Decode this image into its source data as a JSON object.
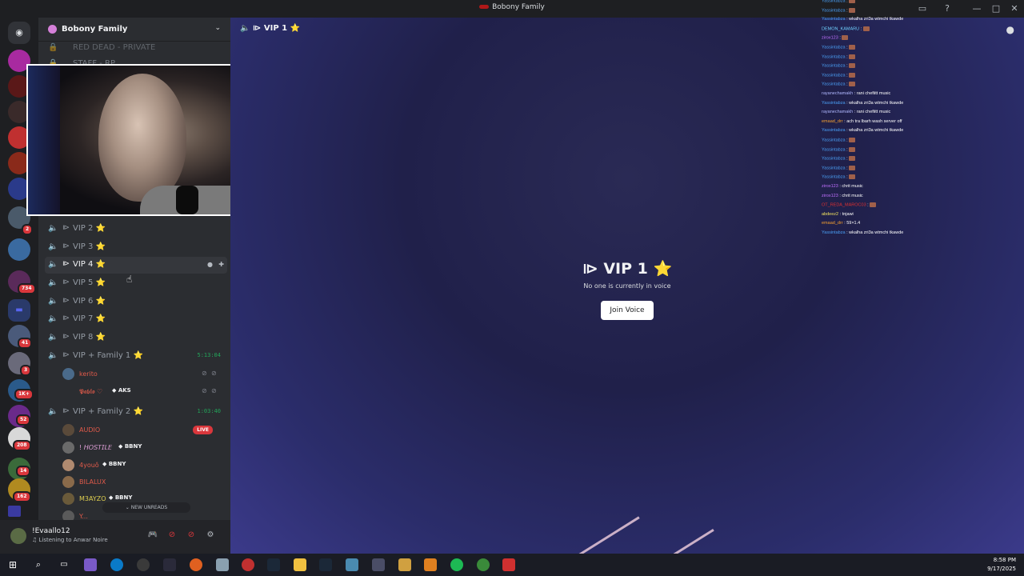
{
  "window": {
    "title": "Bobony Family"
  },
  "server": {
    "name": "Bobony Family"
  },
  "rail": {
    "badges": [
      "2",
      "734",
      "41",
      "3",
      "1K+",
      "52",
      "208",
      "14",
      "162"
    ]
  },
  "channels_partial": [
    {
      "name": "RED DEAD - PRIVATE"
    },
    {
      "name": "STAFF - RP"
    }
  ],
  "channels": [
    {
      "name": "VIP 2 ⭐"
    },
    {
      "name": "VIP 3 ⭐"
    },
    {
      "name": "VIP 4 ⭐"
    },
    {
      "name": "VIP 5 ⭐"
    },
    {
      "name": "VIP 6 ⭐"
    },
    {
      "name": "VIP 7 ⭐"
    },
    {
      "name": "VIP 8 ⭐"
    }
  ],
  "family1": {
    "name": "VIP + Family 1 ⭐",
    "timer": "5:13:04",
    "members": [
      {
        "name": "kerito",
        "color": "#e05a4a"
      },
      {
        "name": "𝕻𝖆𝖇𝖑𝖔 ♡",
        "color": "#e05a4a",
        "tag": "AKS"
      }
    ]
  },
  "family2": {
    "name": "VIP + Family 2 ⭐",
    "timer": "1:03:40",
    "members": [
      {
        "name": "AUDIO",
        "color": "#e05a4a",
        "live": "LIVE"
      },
      {
        "name": "! 𝘏𝘖𝘚𝘛𝘐𝘓𝘌",
        "color": "#e0a0d8",
        "tag": "BBNY"
      },
      {
        "name": "4youô",
        "color": "#e05a4a",
        "tag": "BBNY"
      },
      {
        "name": "BILALUX",
        "color": "#e05a4a"
      },
      {
        "name": "M3AYZO",
        "color": "#e0d050",
        "tag": "BBNY"
      },
      {
        "name": "Y...",
        "color": "#e05a4a"
      }
    ]
  },
  "new_unreads": "NEW UNREADS",
  "user": {
    "name": "!Evaallo12",
    "status": "Listening to Anwar Noire"
  },
  "main": {
    "header": "VIP 1 ⭐",
    "big_title": "VIP 1 ⭐",
    "empty_text": "No one is currently in voice",
    "join_button": "Join Voice"
  },
  "chat_overlay": [
    {
      "user": "Yassintabza",
      "color": "#4a9ff5",
      "msg": "",
      "emoji": true
    },
    {
      "user": "Yassintabza",
      "color": "#4a9ff5",
      "msg": "",
      "emoji": true
    },
    {
      "user": "Yassintabza",
      "color": "#4a9ff5",
      "msg": "wkalha zri3a wtmchi tkawde",
      "emoji": false
    },
    {
      "user": "DEMON_KAMARU",
      "color": "#6fd0ff",
      "msg": "",
      "emoji": true
    },
    {
      "user": "zirox123",
      "color": "#c070ff",
      "msg": "",
      "emoji": true
    },
    {
      "user": "Yassintabza",
      "color": "#4a9ff5",
      "msg": "",
      "emoji": true
    },
    {
      "user": "Yassintabza",
      "color": "#4a9ff5",
      "msg": "",
      "emoji": true
    },
    {
      "user": "Yassintabza",
      "color": "#4a9ff5",
      "msg": "",
      "emoji": true
    },
    {
      "user": "Yassintabza",
      "color": "#4a9ff5",
      "msg": "",
      "emoji": true
    },
    {
      "user": "Yassintabza",
      "color": "#4a9ff5",
      "msg": "",
      "emoji": true
    },
    {
      "user": "rayanechamakh",
      "color": "#b0b8ff",
      "msg": "rani chefiitt music",
      "emoji": false
    },
    {
      "user": "Yassintabza",
      "color": "#4a9ff5",
      "msg": "wkalha zri3a wtmchi tkawde",
      "emoji": false
    },
    {
      "user": "rayanechamakh",
      "color": "#b0b8ff",
      "msg": "rani chefiitt music",
      "emoji": false
    },
    {
      "user": "emaad_drr",
      "color": "#f5a030",
      "msg": "ach tra lbarh wash server off",
      "emoji": false
    },
    {
      "user": "Yassintabza",
      "color": "#4a9ff5",
      "msg": "wkalha zri3a wtmchi tkawde",
      "emoji": false
    },
    {
      "user": "Yassintabza",
      "color": "#4a9ff5",
      "msg": "",
      "emoji": true
    },
    {
      "user": "Yassintabza",
      "color": "#4a9ff5",
      "msg": "",
      "emoji": true
    },
    {
      "user": "Yassintabza",
      "color": "#4a9ff5",
      "msg": "",
      "emoji": true
    },
    {
      "user": "Yassintabza",
      "color": "#4a9ff5",
      "msg": "",
      "emoji": true
    },
    {
      "user": "Yassintabza",
      "color": "#4a9ff5",
      "msg": "",
      "emoji": true
    },
    {
      "user": "zirox123",
      "color": "#c070ff",
      "msg": "chrit music",
      "emoji": false
    },
    {
      "user": "zirox123",
      "color": "#c070ff",
      "msg": "chrit music",
      "emoji": false
    },
    {
      "user": "OT_REDA_MAROC03",
      "color": "#e03030",
      "msg": "",
      "emoji": true
    },
    {
      "user": "abdeez2",
      "color": "#f0e060",
      "msg": "tnjawi",
      "emoji": false
    },
    {
      "user": "emaad_drr",
      "color": "#f5a030",
      "msg": "59×1.4",
      "emoji": false
    },
    {
      "user": "Yassintabza",
      "color": "#4a9ff5",
      "msg": "wkalha zri3a wtmchi tkawde",
      "emoji": false
    }
  ],
  "taskbar": {
    "time": "8:58 PM",
    "date": "9/17/2025"
  }
}
